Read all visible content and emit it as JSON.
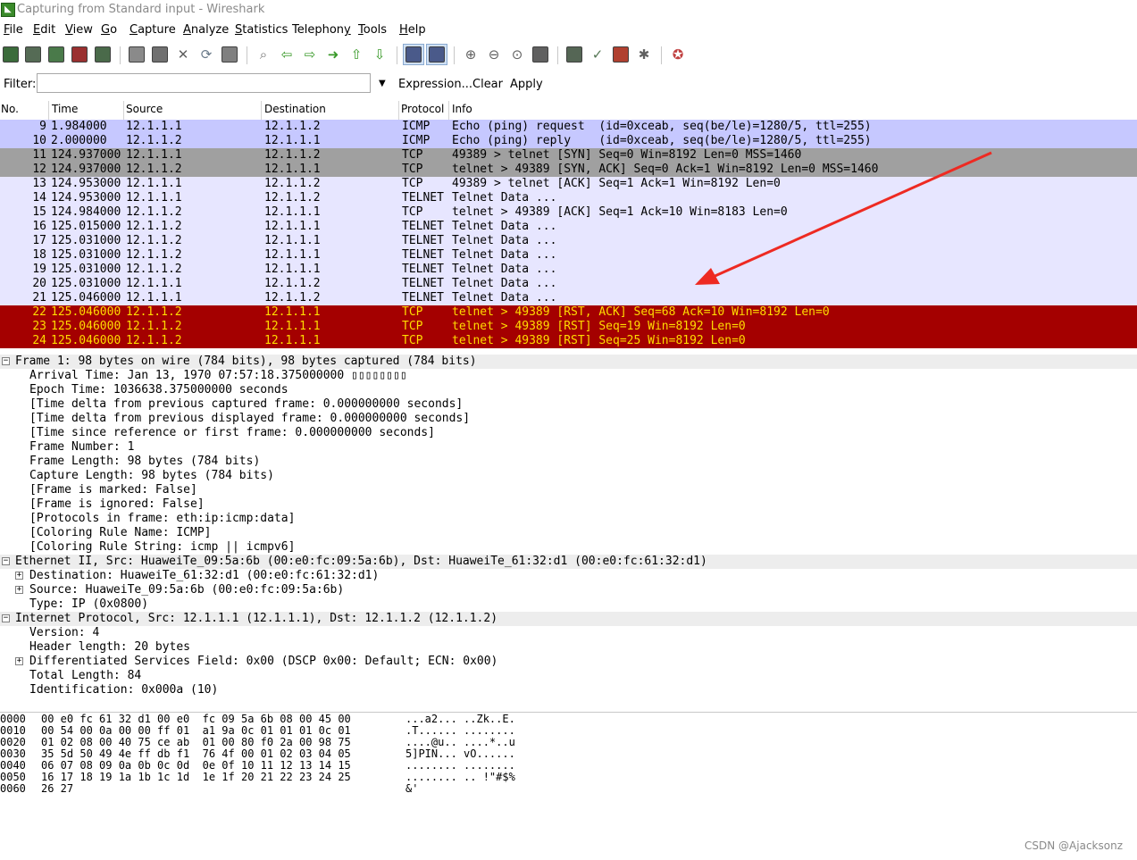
{
  "window": {
    "title": "Capturing from Standard input - Wireshark",
    "icon": "wireshark-fin-icon"
  },
  "menu": [
    {
      "u": "F",
      "rest": "ile"
    },
    {
      "u": "E",
      "rest": "dit"
    },
    {
      "u": "V",
      "rest": "iew"
    },
    {
      "u": "G",
      "rest": "o"
    },
    {
      "u": "C",
      "rest": "apture"
    },
    {
      "u": "A",
      "rest": "nalyze"
    },
    {
      "u": "S",
      "rest": "tatistics"
    },
    {
      "u": "",
      "rest": "Telephon",
      "u2": "y"
    },
    {
      "u": "T",
      "rest": "ools"
    },
    {
      "u": "H",
      "rest": "elp"
    }
  ],
  "toolbar_icons": [
    "interfaces-icon",
    "options-icon",
    "start-icon",
    "stop-icon",
    "restart-icon",
    "open-icon",
    "save-icon",
    "close-icon",
    "reload-icon",
    "print-icon",
    "find-icon",
    "back-icon",
    "forward-icon",
    "goto-icon",
    "first-icon",
    "last-icon",
    "colorize-icon",
    "autoscroll-icon",
    "zoom-in-icon",
    "zoom-out-icon",
    "zoom-normal-icon",
    "resize-columns-icon",
    "capture-filters-icon",
    "display-filters-icon",
    "coloring-rules-icon",
    "preferences-icon",
    "help-icon"
  ],
  "filter": {
    "label": "Filter:",
    "value": "",
    "expression": "Expression...",
    "clear": "Clear",
    "apply": "Apply"
  },
  "columns": [
    "No.",
    "Time",
    "Source",
    "Destination",
    "Protocol",
    "Info"
  ],
  "colors": {
    "icmp_bg": "#c6c8ff",
    "tcp_syn_bg": "#a0a0a0",
    "tcp_bg": "#e7e6ff",
    "rst_bg": "#a40000",
    "rst_fg": "#ffdc00"
  },
  "packets": [
    {
      "no": "9",
      "time": "1.984000",
      "src": "12.1.1.1",
      "dst": "12.1.1.2",
      "proto": "ICMP",
      "info": "Echo (ping) request  (id=0xceab, seq(be/le)=1280/5, ttl=255)",
      "style": "icmp"
    },
    {
      "no": "10",
      "time": "2.000000",
      "src": "12.1.1.2",
      "dst": "12.1.1.1",
      "proto": "ICMP",
      "info": "Echo (ping) reply    (id=0xceab, seq(be/le)=1280/5, ttl=255)",
      "style": "icmp"
    },
    {
      "no": "11",
      "time": "124.937000",
      "src": "12.1.1.1",
      "dst": "12.1.1.2",
      "proto": "TCP",
      "info": "49389 > telnet [SYN] Seq=0 Win=8192 Len=0 MSS=1460",
      "style": "syn"
    },
    {
      "no": "12",
      "time": "124.937000",
      "src": "12.1.1.2",
      "dst": "12.1.1.1",
      "proto": "TCP",
      "info": "telnet > 49389 [SYN, ACK] Seq=0 Ack=1 Win=8192 Len=0 MSS=1460",
      "style": "syn"
    },
    {
      "no": "13",
      "time": "124.953000",
      "src": "12.1.1.1",
      "dst": "12.1.1.2",
      "proto": "TCP",
      "info": "49389 > telnet [ACK] Seq=1 Ack=1 Win=8192 Len=0",
      "style": "tcp"
    },
    {
      "no": "14",
      "time": "124.953000",
      "src": "12.1.1.1",
      "dst": "12.1.1.2",
      "proto": "TELNET",
      "info": "Telnet Data ...",
      "style": "tcp"
    },
    {
      "no": "15",
      "time": "124.984000",
      "src": "12.1.1.2",
      "dst": "12.1.1.1",
      "proto": "TCP",
      "info": "telnet > 49389 [ACK] Seq=1 Ack=10 Win=8183 Len=0",
      "style": "tcp"
    },
    {
      "no": "16",
      "time": "125.015000",
      "src": "12.1.1.2",
      "dst": "12.1.1.1",
      "proto": "TELNET",
      "info": "Telnet Data ...",
      "style": "tcp"
    },
    {
      "no": "17",
      "time": "125.031000",
      "src": "12.1.1.2",
      "dst": "12.1.1.1",
      "proto": "TELNET",
      "info": "Telnet Data ...",
      "style": "tcp"
    },
    {
      "no": "18",
      "time": "125.031000",
      "src": "12.1.1.2",
      "dst": "12.1.1.1",
      "proto": "TELNET",
      "info": "Telnet Data ...",
      "style": "tcp"
    },
    {
      "no": "19",
      "time": "125.031000",
      "src": "12.1.1.2",
      "dst": "12.1.1.1",
      "proto": "TELNET",
      "info": "Telnet Data ...",
      "style": "tcp"
    },
    {
      "no": "20",
      "time": "125.031000",
      "src": "12.1.1.1",
      "dst": "12.1.1.2",
      "proto": "TELNET",
      "info": "Telnet Data ...",
      "style": "tcp"
    },
    {
      "no": "21",
      "time": "125.046000",
      "src": "12.1.1.1",
      "dst": "12.1.1.2",
      "proto": "TELNET",
      "info": "Telnet Data ...",
      "style": "tcp"
    },
    {
      "no": "22",
      "time": "125.046000",
      "src": "12.1.1.2",
      "dst": "12.1.1.1",
      "proto": "TCP",
      "info": "telnet > 49389 [RST, ACK] Seq=68 Ack=10 Win=8192 Len=0",
      "style": "rst"
    },
    {
      "no": "23",
      "time": "125.046000",
      "src": "12.1.1.2",
      "dst": "12.1.1.1",
      "proto": "TCP",
      "info": "telnet > 49389 [RST] Seq=19 Win=8192 Len=0",
      "style": "rst"
    },
    {
      "no": "24",
      "time": "125.046000",
      "src": "12.1.1.2",
      "dst": "12.1.1.1",
      "proto": "TCP",
      "info": "telnet > 49389 [RST] Seq=25 Win=8192 Len=0",
      "style": "rst"
    }
  ],
  "details": [
    {
      "text": "Frame 1: 98 bytes on wire (784 bits), 98 bytes captured (784 bits)",
      "level": 0,
      "expander": "minus",
      "top": true
    },
    {
      "text": "Arrival Time: Jan 13, 1970 07:57:18.375000000 ▯▯▯▯▯▯▯▯",
      "level": 1
    },
    {
      "text": "Epoch Time: 1036638.375000000 seconds",
      "level": 1
    },
    {
      "text": "[Time delta from previous captured frame: 0.000000000 seconds]",
      "level": 1
    },
    {
      "text": "[Time delta from previous displayed frame: 0.000000000 seconds]",
      "level": 1
    },
    {
      "text": "[Time since reference or first frame: 0.000000000 seconds]",
      "level": 1
    },
    {
      "text": "Frame Number: 1",
      "level": 1
    },
    {
      "text": "Frame Length: 98 bytes (784 bits)",
      "level": 1
    },
    {
      "text": "Capture Length: 98 bytes (784 bits)",
      "level": 1
    },
    {
      "text": "[Frame is marked: False]",
      "level": 1
    },
    {
      "text": "[Frame is ignored: False]",
      "level": 1
    },
    {
      "text": "[Protocols in frame: eth:ip:icmp:data]",
      "level": 1
    },
    {
      "text": "[Coloring Rule Name: ICMP]",
      "level": 1
    },
    {
      "text": "[Coloring Rule String: icmp || icmpv6]",
      "level": 1
    },
    {
      "text": "Ethernet II, Src: HuaweiTe_09:5a:6b (00:e0:fc:09:5a:6b), Dst: HuaweiTe_61:32:d1 (00:e0:fc:61:32:d1)",
      "level": 0,
      "expander": "minus",
      "top": true
    },
    {
      "text": "Destination: HuaweiTe_61:32:d1 (00:e0:fc:61:32:d1)",
      "level": 1,
      "expander": "plus"
    },
    {
      "text": "Source: HuaweiTe_09:5a:6b (00:e0:fc:09:5a:6b)",
      "level": 1,
      "expander": "plus"
    },
    {
      "text": "Type: IP (0x0800)",
      "level": 1
    },
    {
      "text": "Internet Protocol, Src: 12.1.1.1 (12.1.1.1), Dst: 12.1.1.2 (12.1.1.2)",
      "level": 0,
      "expander": "minus",
      "top": true
    },
    {
      "text": "Version: 4",
      "level": 1
    },
    {
      "text": "Header length: 20 bytes",
      "level": 1
    },
    {
      "text": "Differentiated Services Field: 0x00 (DSCP 0x00: Default; ECN: 0x00)",
      "level": 1,
      "expander": "plus"
    },
    {
      "text": "Total Length: 84",
      "level": 1
    },
    {
      "text": "Identification: 0x000a (10)",
      "level": 1
    }
  ],
  "hex": [
    {
      "off": "0000",
      "bytes": "00 e0 fc 61 32 d1 00 e0  fc 09 5a 6b 08 00 45 00",
      "ascii": "...a2... ..Zk..E."
    },
    {
      "off": "0010",
      "bytes": "00 54 00 0a 00 00 ff 01  a1 9a 0c 01 01 01 0c 01",
      "ascii": ".T...... ........"
    },
    {
      "off": "0020",
      "bytes": "01 02 08 00 40 75 ce ab  01 00 80 f0 2a 00 98 75",
      "ascii": "....@u.. ....*..u"
    },
    {
      "off": "0030",
      "bytes": "35 5d 50 49 4e ff db f1  76 4f 00 01 02 03 04 05",
      "ascii": "5]PIN... vO......"
    },
    {
      "off": "0040",
      "bytes": "06 07 08 09 0a 0b 0c 0d  0e 0f 10 11 12 13 14 15",
      "ascii": "........ ........"
    },
    {
      "off": "0050",
      "bytes": "16 17 18 19 1a 1b 1c 1d  1e 1f 20 21 22 23 24 25",
      "ascii": "........ .. !\"#$%"
    },
    {
      "off": "0060",
      "bytes": "26 27",
      "ascii": "&'"
    }
  ],
  "watermark": "CSDN @Ajacksonz"
}
